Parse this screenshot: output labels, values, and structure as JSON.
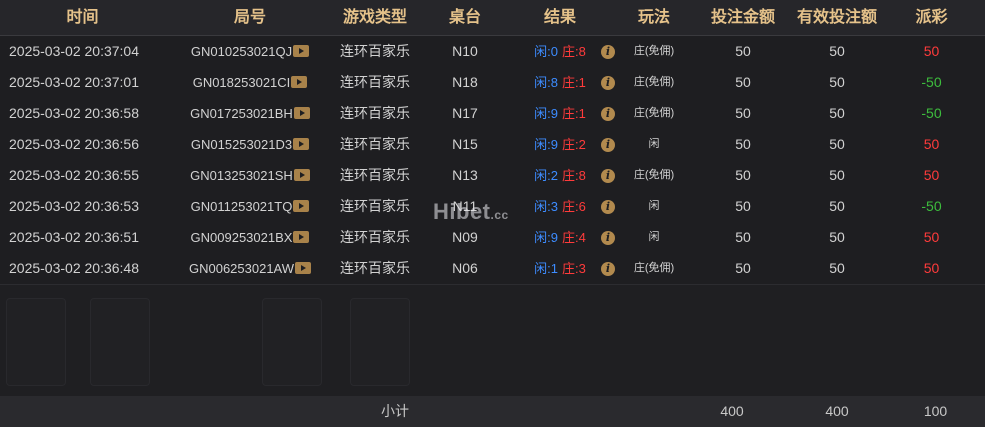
{
  "headers": {
    "time": "时间",
    "round": "局号",
    "game_type": "游戏类型",
    "table": "桌台",
    "result": "结果",
    "play": "玩法",
    "bet_amount": "投注金额",
    "valid_bet": "有效投注额",
    "payout": "派彩"
  },
  "rows": [
    {
      "time": "2025-03-02 20:37:04",
      "round": "GN010253021QJ",
      "game": "连环百家乐",
      "table": "N10",
      "player_label": "闲",
      "player": "0",
      "banker_label": "庄",
      "banker": "8",
      "play": "庄(免佣)",
      "bet": "50",
      "valid": "50",
      "payout": "50",
      "payout_sign": "pos"
    },
    {
      "time": "2025-03-02 20:37:01",
      "round": "GN018253021CI",
      "game": "连环百家乐",
      "table": "N18",
      "player_label": "闲",
      "player": "8",
      "banker_label": "庄",
      "banker": "1",
      "play": "庄(免佣)",
      "bet": "50",
      "valid": "50",
      "payout": "-50",
      "payout_sign": "neg"
    },
    {
      "time": "2025-03-02 20:36:58",
      "round": "GN017253021BH",
      "game": "连环百家乐",
      "table": "N17",
      "player_label": "闲",
      "player": "9",
      "banker_label": "庄",
      "banker": "1",
      "play": "庄(免佣)",
      "bet": "50",
      "valid": "50",
      "payout": "-50",
      "payout_sign": "neg"
    },
    {
      "time": "2025-03-02 20:36:56",
      "round": "GN015253021D3",
      "game": "连环百家乐",
      "table": "N15",
      "player_label": "闲",
      "player": "9",
      "banker_label": "庄",
      "banker": "2",
      "play": "闲",
      "bet": "50",
      "valid": "50",
      "payout": "50",
      "payout_sign": "pos"
    },
    {
      "time": "2025-03-02 20:36:55",
      "round": "GN013253021SH",
      "game": "连环百家乐",
      "table": "N13",
      "player_label": "闲",
      "player": "2",
      "banker_label": "庄",
      "banker": "8",
      "play": "庄(免佣)",
      "bet": "50",
      "valid": "50",
      "payout": "50",
      "payout_sign": "pos"
    },
    {
      "time": "2025-03-02 20:36:53",
      "round": "GN011253021TQ",
      "game": "连环百家乐",
      "table": "N11",
      "player_label": "闲",
      "player": "3",
      "banker_label": "庄",
      "banker": "6",
      "play": "闲",
      "bet": "50",
      "valid": "50",
      "payout": "-50",
      "payout_sign": "neg"
    },
    {
      "time": "2025-03-02 20:36:51",
      "round": "GN009253021BX",
      "game": "连环百家乐",
      "table": "N09",
      "player_label": "闲",
      "player": "9",
      "banker_label": "庄",
      "banker": "4",
      "play": "闲",
      "bet": "50",
      "valid": "50",
      "payout": "50",
      "payout_sign": "pos"
    },
    {
      "time": "2025-03-02 20:36:48",
      "round": "GN006253021AW",
      "game": "连环百家乐",
      "table": "N06",
      "player_label": "闲",
      "player": "1",
      "banker_label": "庄",
      "banker": "3",
      "play": "庄(免佣)",
      "bet": "50",
      "valid": "50",
      "payout": "50",
      "payout_sign": "pos"
    }
  ],
  "footer": {
    "label": "小计",
    "bet_total": "400",
    "valid_total": "400",
    "payout_total": "100"
  },
  "watermark": {
    "main": "Hibet",
    "sub": ".cc"
  },
  "icons": {
    "video": "play-video-icon",
    "info": "info-icon"
  },
  "colors": {
    "header_text": "#e5c28a",
    "player": "#3d8cff",
    "banker": "#ff3b3b",
    "win": "#ff3b3b",
    "loss": "#3dbd3d"
  }
}
